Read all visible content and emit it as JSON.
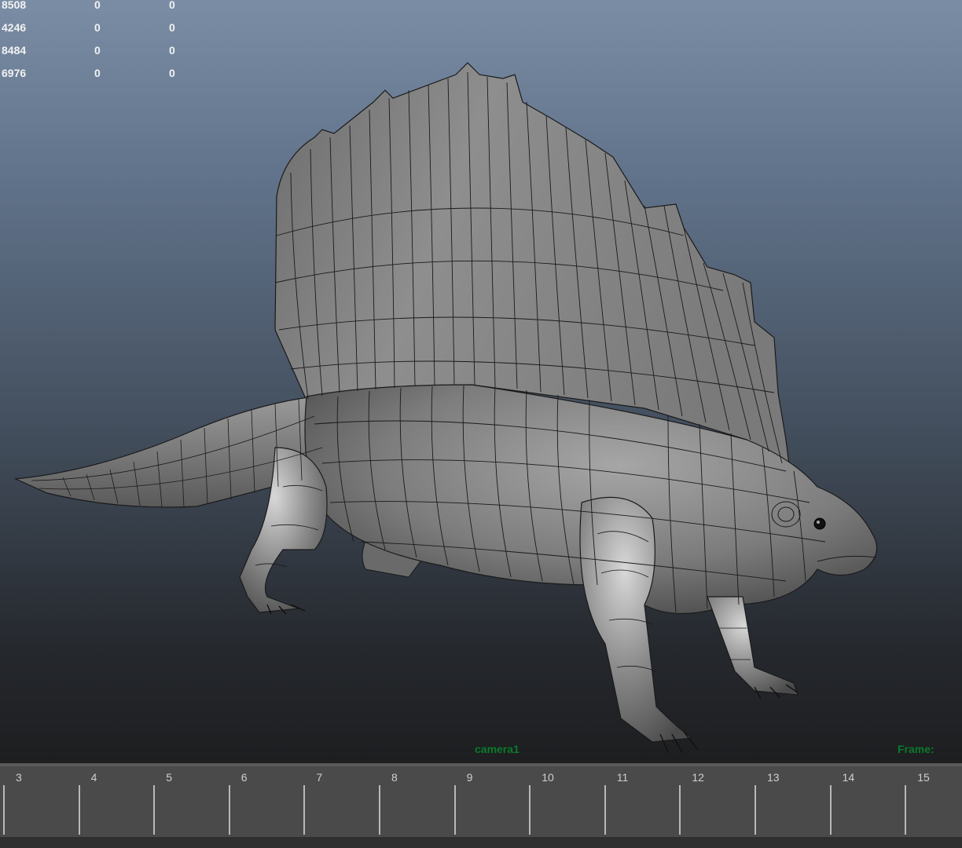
{
  "hud": {
    "rows": [
      {
        "label": "8508",
        "val1": "0",
        "val2": "0"
      },
      {
        "label": "4246",
        "val1": "0",
        "val2": "0"
      },
      {
        "label": "8484",
        "val1": "0",
        "val2": "0"
      },
      {
        "label": "6976",
        "val1": "0",
        "val2": "0"
      }
    ]
  },
  "viewport": {
    "camera_label": "camera1",
    "frame_label": "Frame:"
  },
  "timeline": {
    "ticks": [
      "3",
      "4",
      "5",
      "6",
      "7",
      "8",
      "9",
      "10",
      "11",
      "12",
      "13",
      "14",
      "15"
    ]
  },
  "colors": {
    "hud_text": "#f2f2f2",
    "camera_label": "#0a7a2a",
    "timeline_bg": "#4a4a4a",
    "mesh_fill": "#8a8a8a",
    "wire": "#1a1a1a"
  }
}
